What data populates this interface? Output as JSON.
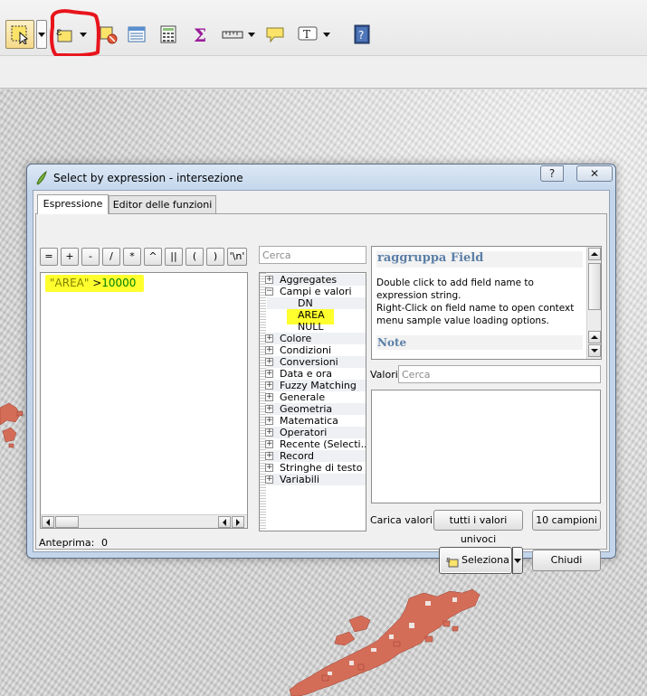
{
  "toolbar": {
    "icons": [
      "select-features-icon",
      "select-by-expression-icon",
      "deselect-icon",
      "attribute-table-icon",
      "field-calculator-icon",
      "statistics-icon",
      "measure-icon",
      "map-tips-icon",
      "text-annotation-icon",
      "help-icon"
    ]
  },
  "dialog": {
    "title": "Select by expression - intersezione",
    "help_button": "?",
    "close_button": "✕",
    "tabs": [
      {
        "label": "Espressione"
      },
      {
        "label": "Editor delle funzioni"
      }
    ],
    "operators": [
      "=",
      "+",
      "-",
      "/",
      "*",
      "^",
      "||",
      "(",
      ")",
      "'\\n'"
    ],
    "expression": {
      "field": "\"AREA\"",
      "operator": " >",
      "value": "10000"
    },
    "preview_label": "Anteprima:",
    "preview_value": "0",
    "function_search_placeholder": "Cerca",
    "function_tree": [
      {
        "label": "Aggregates",
        "expanded": false
      },
      {
        "label": "Campi e valori",
        "expanded": true,
        "children": [
          "DN",
          "AREA",
          "NULL"
        ]
      },
      {
        "label": "Colore",
        "expanded": false
      },
      {
        "label": "Condizioni",
        "expanded": false
      },
      {
        "label": "Conversioni",
        "expanded": false
      },
      {
        "label": "Data e ora",
        "expanded": false
      },
      {
        "label": "Fuzzy Matching",
        "expanded": false
      },
      {
        "label": "Generale",
        "expanded": false
      },
      {
        "label": "Geometria",
        "expanded": false
      },
      {
        "label": "Matematica",
        "expanded": false
      },
      {
        "label": "Operatori",
        "expanded": false
      },
      {
        "label": "Recente (Selecti...",
        "expanded": false
      },
      {
        "label": "Record",
        "expanded": false
      },
      {
        "label": "Stringhe di testo",
        "expanded": false
      },
      {
        "label": "Variabili",
        "expanded": false
      }
    ],
    "help": {
      "heading": "raggruppa Field",
      "body": "Double click to add field name to expression string.\nRight-Click on field name to open context menu sample value loading options.",
      "note_heading": "Note"
    },
    "values_label": "Valori",
    "values_search_placeholder": "Cerca",
    "load_values_label": "Carica valori",
    "all_unique_button": "tutti i valori univoci",
    "ten_samples_button": "10 campioni",
    "select_button": "Seleziona",
    "close_dialog_button": "Chiudi"
  },
  "colors": {
    "highlight": "#ffff2e",
    "feature_fill": "#d46d58",
    "marker": "#e8141c",
    "heading": "#5b7fa7"
  }
}
